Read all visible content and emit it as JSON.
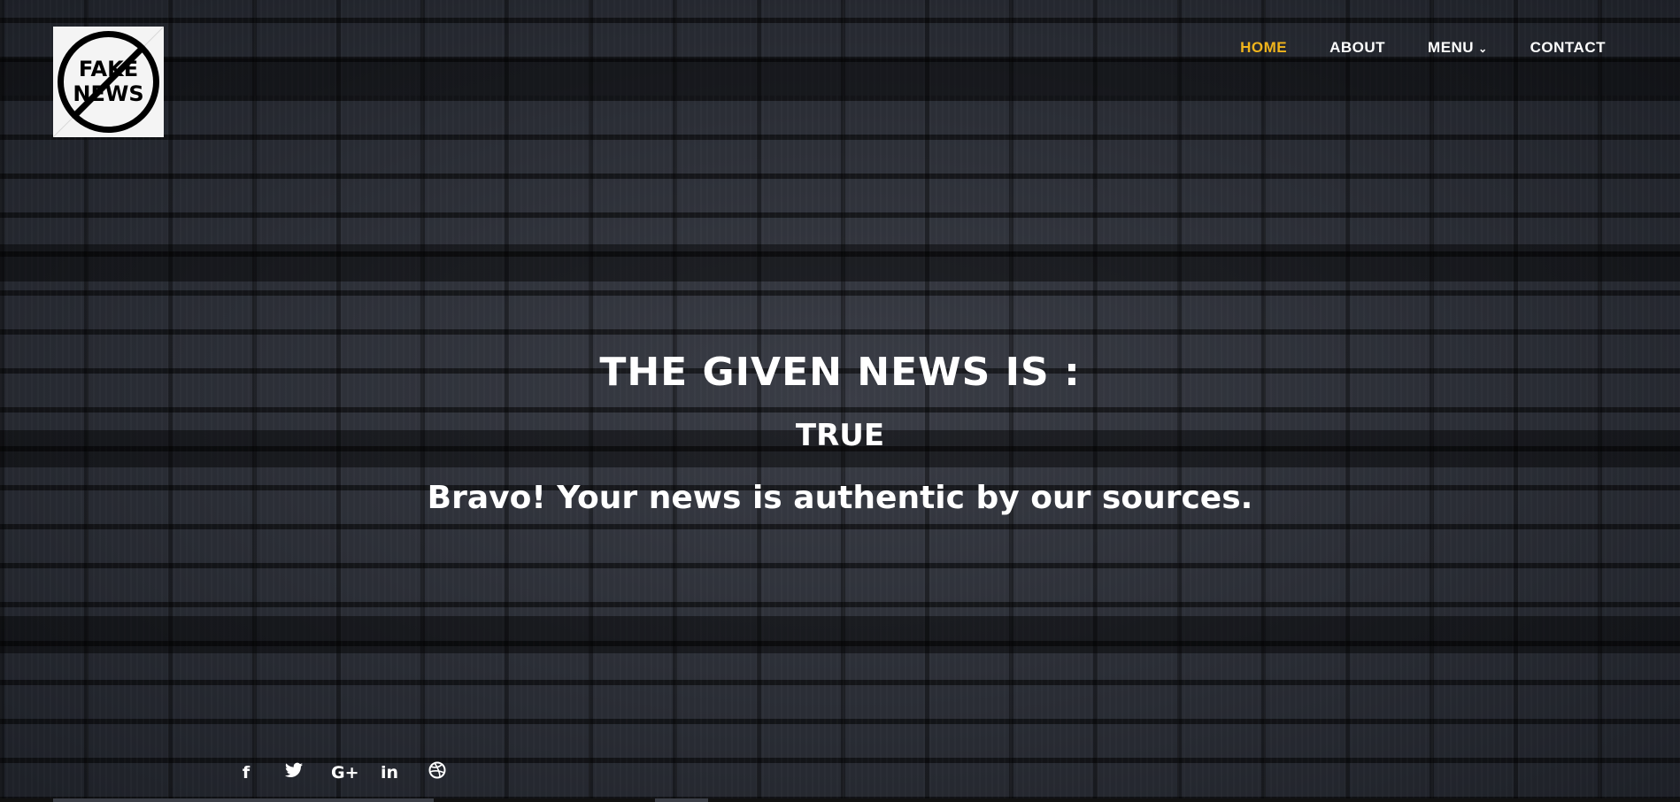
{
  "logo": {
    "text_line1": "FAKE",
    "text_line2": "NEWS"
  },
  "nav": {
    "items": [
      {
        "label": "HOME",
        "active": true
      },
      {
        "label": "ABOUT",
        "active": false
      },
      {
        "label": "MENU",
        "active": false,
        "has_dropdown": true
      },
      {
        "label": "CONTACT",
        "active": false
      }
    ]
  },
  "hero": {
    "headline": "THE GIVEN NEWS IS :",
    "verdict": "TRUE",
    "message": "Bravo! Your news is authentic by our sources."
  },
  "social": {
    "icons": [
      {
        "name": "facebook-icon",
        "glyph": "f"
      },
      {
        "name": "twitter-icon",
        "glyph": "🐦"
      },
      {
        "name": "google-plus-icon",
        "glyph": "G+"
      },
      {
        "name": "linkedin-icon",
        "glyph": "in"
      },
      {
        "name": "dribbble-icon",
        "glyph": "◎"
      }
    ]
  },
  "colors": {
    "accent": "#f1b51c",
    "text": "#ffffff",
    "background": "#23262e"
  }
}
